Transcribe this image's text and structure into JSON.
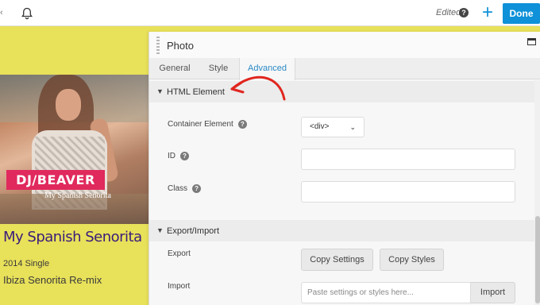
{
  "toolbar": {
    "status": "Edited",
    "help": "?",
    "add": "+",
    "done_label": "Done",
    "accent": "#0e91d8"
  },
  "preview": {
    "badge": "DJ/BEAVER",
    "badge_subtitle": "My Spanish Senorita",
    "title": "My Spanish Senorita",
    "subtitle": "2014 Single",
    "mix": "Ibiza Senorita Re-mix",
    "title_color": "#3a1c7a",
    "badge_color": "#e0295d"
  },
  "panel": {
    "title": "Photo",
    "tabs": [
      {
        "label": "General",
        "active": false
      },
      {
        "label": "Style",
        "active": false
      },
      {
        "label": "Advanced",
        "active": true
      }
    ],
    "sections": {
      "html": {
        "title": "HTML Element",
        "container_label": "Container Element",
        "container_value": "<div>",
        "id_label": "ID",
        "class_label": "Class"
      },
      "export": {
        "title": "Export/Import",
        "export_label": "Export",
        "copy_settings": "Copy Settings",
        "copy_styles": "Copy Styles",
        "import_label": "Import",
        "import_placeholder": "Paste settings or styles here...",
        "import_button": "Import"
      }
    },
    "help": "?"
  },
  "icons": {
    "bell": "bell-icon",
    "maximize": "window-maximize-icon",
    "chevron": "chevron-down-icon",
    "arrow": "red-annotation-arrow"
  }
}
